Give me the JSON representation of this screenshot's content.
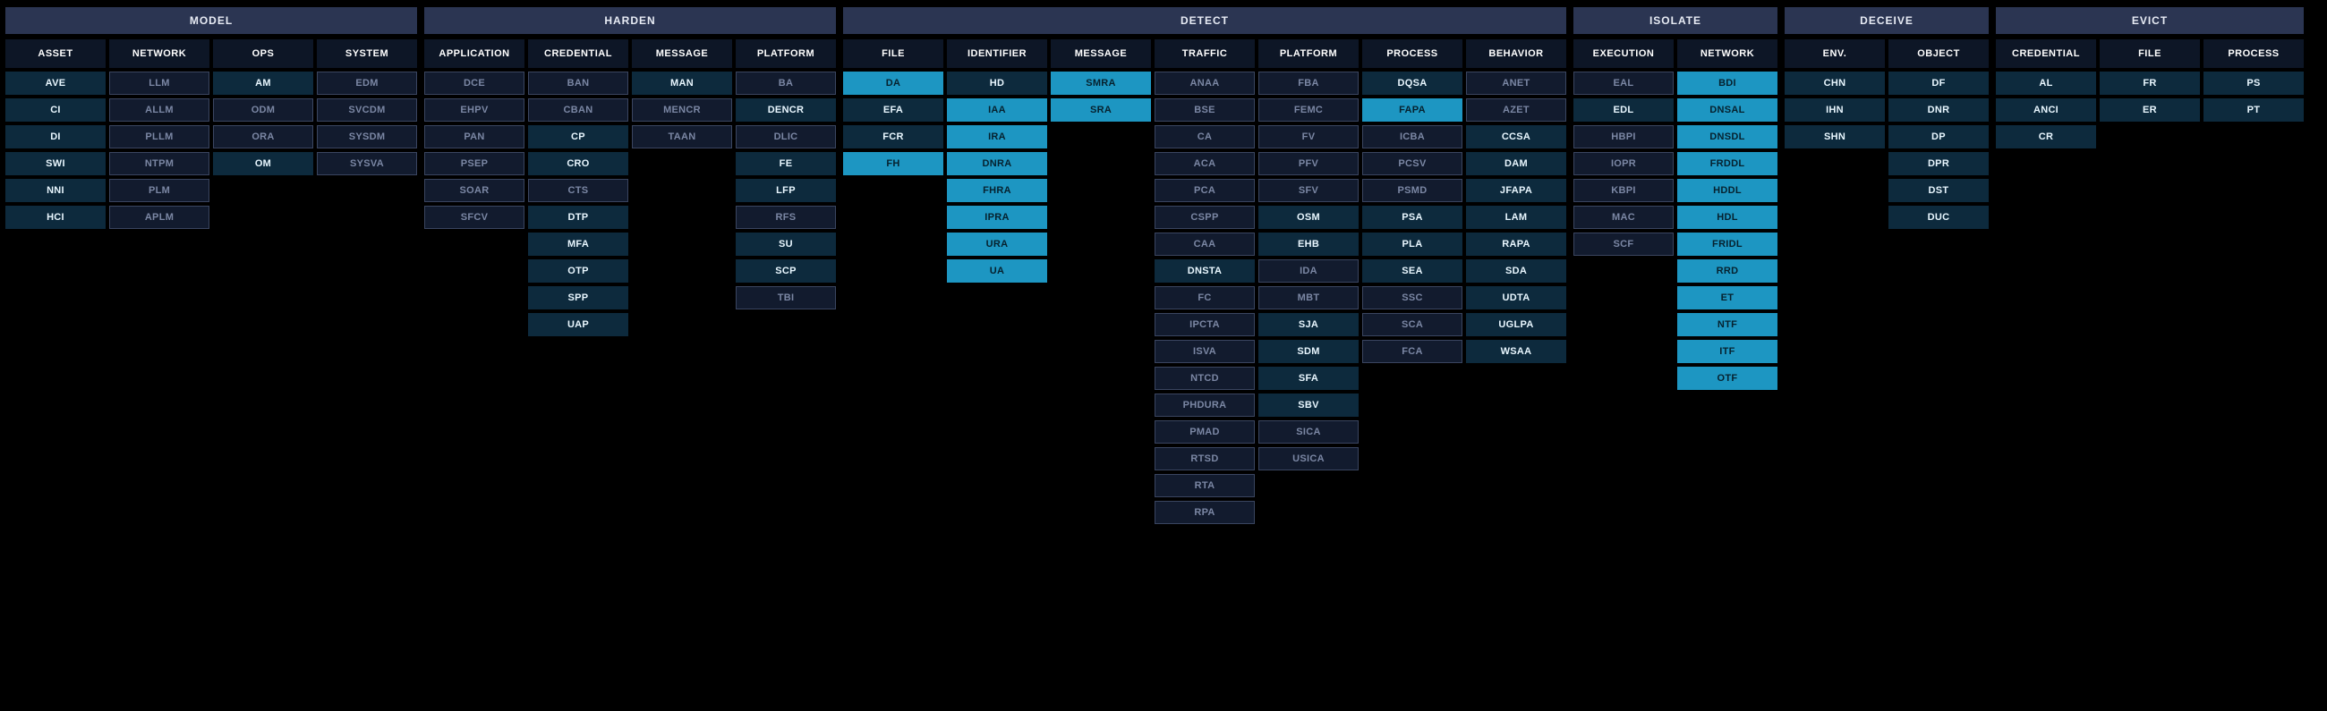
{
  "groups": [
    {
      "name": "MODEL",
      "columns": [
        {
          "name": "ASSET",
          "cells": [
            {
              "t": "AVE",
              "v": "dark"
            },
            {
              "t": "CI",
              "v": "dark"
            },
            {
              "t": "DI",
              "v": "dark"
            },
            {
              "t": "SWI",
              "v": "dark"
            },
            {
              "t": "NNI",
              "v": "dark"
            },
            {
              "t": "HCI",
              "v": "dark"
            }
          ]
        },
        {
          "name": "NETWORK",
          "cells": [
            {
              "t": "LLM",
              "v": "dim"
            },
            {
              "t": "ALLM",
              "v": "dim"
            },
            {
              "t": "PLLM",
              "v": "dim"
            },
            {
              "t": "NTPM",
              "v": "dim"
            },
            {
              "t": "PLM",
              "v": "dim"
            },
            {
              "t": "APLM",
              "v": "dim"
            }
          ]
        },
        {
          "name": "OPS",
          "cells": [
            {
              "t": "AM",
              "v": "dark"
            },
            {
              "t": "ODM",
              "v": "dim"
            },
            {
              "t": "ORA",
              "v": "dim"
            },
            {
              "t": "OM",
              "v": "dark"
            }
          ]
        },
        {
          "name": "SYSTEM",
          "cells": [
            {
              "t": "EDM",
              "v": "dim"
            },
            {
              "t": "SVCDM",
              "v": "dim"
            },
            {
              "t": "SYSDM",
              "v": "dim"
            },
            {
              "t": "SYSVA",
              "v": "dim"
            }
          ]
        }
      ]
    },
    {
      "name": "HARDEN",
      "columns": [
        {
          "name": "APPLICATION",
          "cells": [
            {
              "t": "DCE",
              "v": "dim"
            },
            {
              "t": "EHPV",
              "v": "dim"
            },
            {
              "t": "PAN",
              "v": "dim"
            },
            {
              "t": "PSEP",
              "v": "dim"
            },
            {
              "t": "SOAR",
              "v": "dim"
            },
            {
              "t": "SFCV",
              "v": "dim"
            }
          ]
        },
        {
          "name": "CREDENTIAL",
          "cells": [
            {
              "t": "BAN",
              "v": "dim"
            },
            {
              "t": "CBAN",
              "v": "dim"
            },
            {
              "t": "CP",
              "v": "dark"
            },
            {
              "t": "CRO",
              "v": "dark"
            },
            {
              "t": "CTS",
              "v": "dim"
            },
            {
              "t": "DTP",
              "v": "dark"
            },
            {
              "t": "MFA",
              "v": "dark"
            },
            {
              "t": "OTP",
              "v": "dark"
            },
            {
              "t": "SPP",
              "v": "dark"
            },
            {
              "t": "UAP",
              "v": "dark"
            }
          ]
        },
        {
          "name": "MESSAGE",
          "cells": [
            {
              "t": "MAN",
              "v": "dark"
            },
            {
              "t": "MENCR",
              "v": "dim"
            },
            {
              "t": "TAAN",
              "v": "dim"
            }
          ]
        },
        {
          "name": "PLATFORM",
          "cells": [
            {
              "t": "BA",
              "v": "dim"
            },
            {
              "t": "DENCR",
              "v": "dark"
            },
            {
              "t": "DLIC",
              "v": "dim"
            },
            {
              "t": "FE",
              "v": "dark"
            },
            {
              "t": "LFP",
              "v": "dark"
            },
            {
              "t": "RFS",
              "v": "dim"
            },
            {
              "t": "SU",
              "v": "dark"
            },
            {
              "t": "SCP",
              "v": "dark"
            },
            {
              "t": "TBI",
              "v": "dim"
            }
          ]
        }
      ]
    },
    {
      "name": "DETECT",
      "columns": [
        {
          "name": "FILE",
          "cells": [
            {
              "t": "DA",
              "v": "bright"
            },
            {
              "t": "EFA",
              "v": "dark"
            },
            {
              "t": "FCR",
              "v": "dark"
            },
            {
              "t": "FH",
              "v": "bright"
            }
          ]
        },
        {
          "name": "IDENTIFIER",
          "cells": [
            {
              "t": "HD",
              "v": "dark"
            },
            {
              "t": "IAA",
              "v": "bright"
            },
            {
              "t": "IRA",
              "v": "bright"
            },
            {
              "t": "DNRA",
              "v": "bright"
            },
            {
              "t": "FHRA",
              "v": "bright"
            },
            {
              "t": "IPRA",
              "v": "bright"
            },
            {
              "t": "URA",
              "v": "bright"
            },
            {
              "t": "UA",
              "v": "bright"
            }
          ]
        },
        {
          "name": "MESSAGE",
          "cells": [
            {
              "t": "SMRA",
              "v": "bright"
            },
            {
              "t": "SRA",
              "v": "bright"
            }
          ]
        },
        {
          "name": "TRAFFIC",
          "cells": [
            {
              "t": "ANAA",
              "v": "dim"
            },
            {
              "t": "BSE",
              "v": "dim"
            },
            {
              "t": "CA",
              "v": "dim"
            },
            {
              "t": "ACA",
              "v": "dim"
            },
            {
              "t": "PCA",
              "v": "dim"
            },
            {
              "t": "CSPP",
              "v": "dim"
            },
            {
              "t": "CAA",
              "v": "dim"
            },
            {
              "t": "DNSTA",
              "v": "dark"
            },
            {
              "t": "FC",
              "v": "dim"
            },
            {
              "t": "IPCTA",
              "v": "dim"
            },
            {
              "t": "ISVA",
              "v": "dim"
            },
            {
              "t": "NTCD",
              "v": "dim"
            },
            {
              "t": "PHDURA",
              "v": "dim"
            },
            {
              "t": "PMAD",
              "v": "dim"
            },
            {
              "t": "RTSD",
              "v": "dim"
            },
            {
              "t": "RTA",
              "v": "dim"
            },
            {
              "t": "RPA",
              "v": "dim"
            }
          ]
        },
        {
          "name": "PLATFORM",
          "cells": [
            {
              "t": "FBA",
              "v": "dim"
            },
            {
              "t": "FEMC",
              "v": "dim"
            },
            {
              "t": "FV",
              "v": "dim"
            },
            {
              "t": "PFV",
              "v": "dim"
            },
            {
              "t": "SFV",
              "v": "dim"
            },
            {
              "t": "OSM",
              "v": "dark"
            },
            {
              "t": "EHB",
              "v": "dark"
            },
            {
              "t": "IDA",
              "v": "dim"
            },
            {
              "t": "MBT",
              "v": "dim"
            },
            {
              "t": "SJA",
              "v": "dark"
            },
            {
              "t": "SDM",
              "v": "dark"
            },
            {
              "t": "SFA",
              "v": "dark"
            },
            {
              "t": "SBV",
              "v": "dark"
            },
            {
              "t": "SICA",
              "v": "dim"
            },
            {
              "t": "USICA",
              "v": "dim"
            }
          ]
        },
        {
          "name": "PROCESS",
          "cells": [
            {
              "t": "DQSA",
              "v": "dark"
            },
            {
              "t": "FAPA",
              "v": "bright"
            },
            {
              "t": "ICBA",
              "v": "dim"
            },
            {
              "t": "PCSV",
              "v": "dim"
            },
            {
              "t": "PSMD",
              "v": "dim"
            },
            {
              "t": "PSA",
              "v": "dark"
            },
            {
              "t": "PLA",
              "v": "dark"
            },
            {
              "t": "SEA",
              "v": "dark"
            },
            {
              "t": "SSC",
              "v": "dim"
            },
            {
              "t": "SCA",
              "v": "dim"
            },
            {
              "t": "FCA",
              "v": "dim"
            }
          ]
        },
        {
          "name": "BEHAVIOR",
          "cells": [
            {
              "t": "ANET",
              "v": "dim"
            },
            {
              "t": "AZET",
              "v": "dim"
            },
            {
              "t": "CCSA",
              "v": "dark"
            },
            {
              "t": "DAM",
              "v": "dark"
            },
            {
              "t": "JFAPA",
              "v": "dark"
            },
            {
              "t": "LAM",
              "v": "dark"
            },
            {
              "t": "RAPA",
              "v": "dark"
            },
            {
              "t": "SDA",
              "v": "dark"
            },
            {
              "t": "UDTA",
              "v": "dark"
            },
            {
              "t": "UGLPA",
              "v": "dark"
            },
            {
              "t": "WSAA",
              "v": "dark"
            }
          ]
        }
      ]
    },
    {
      "name": "ISOLATE",
      "columns": [
        {
          "name": "EXECUTION",
          "cells": [
            {
              "t": "EAL",
              "v": "dim"
            },
            {
              "t": "EDL",
              "v": "dark"
            },
            {
              "t": "HBPI",
              "v": "dim"
            },
            {
              "t": "IOPR",
              "v": "dim"
            },
            {
              "t": "KBPI",
              "v": "dim"
            },
            {
              "t": "MAC",
              "v": "dim"
            },
            {
              "t": "SCF",
              "v": "dim"
            }
          ]
        },
        {
          "name": "NETWORK",
          "cells": [
            {
              "t": "BDI",
              "v": "bright"
            },
            {
              "t": "DNSAL",
              "v": "bright"
            },
            {
              "t": "DNSDL",
              "v": "bright"
            },
            {
              "t": "FRDDL",
              "v": "bright"
            },
            {
              "t": "HDDL",
              "v": "bright"
            },
            {
              "t": "HDL",
              "v": "bright"
            },
            {
              "t": "FRIDL",
              "v": "bright"
            },
            {
              "t": "RRD",
              "v": "bright"
            },
            {
              "t": "ET",
              "v": "bright"
            },
            {
              "t": "NTF",
              "v": "bright"
            },
            {
              "t": "ITF",
              "v": "bright"
            },
            {
              "t": "OTF",
              "v": "bright"
            }
          ]
        }
      ]
    },
    {
      "name": "DECEIVE",
      "columns": [
        {
          "name": "ENV.",
          "cells": [
            {
              "t": "CHN",
              "v": "dark"
            },
            {
              "t": "IHN",
              "v": "dark"
            },
            {
              "t": "SHN",
              "v": "dark"
            }
          ]
        },
        {
          "name": "OBJECT",
          "cells": [
            {
              "t": "DF",
              "v": "dark"
            },
            {
              "t": "DNR",
              "v": "dark"
            },
            {
              "t": "DP",
              "v": "dark"
            },
            {
              "t": "DPR",
              "v": "dark"
            },
            {
              "t": "DST",
              "v": "dark"
            },
            {
              "t": "DUC",
              "v": "dark"
            }
          ]
        }
      ]
    },
    {
      "name": "EVICT",
      "columns": [
        {
          "name": "CREDENTIAL",
          "cells": [
            {
              "t": "AL",
              "v": "dark"
            },
            {
              "t": "ANCI",
              "v": "dark"
            },
            {
              "t": "CR",
              "v": "dark"
            }
          ]
        },
        {
          "name": "FILE",
          "cells": [
            {
              "t": "FR",
              "v": "dark"
            },
            {
              "t": "ER",
              "v": "dark"
            }
          ]
        },
        {
          "name": "PROCESS",
          "cells": [
            {
              "t": "PS",
              "v": "dark"
            },
            {
              "t": "PT",
              "v": "dark"
            }
          ]
        }
      ]
    }
  ]
}
